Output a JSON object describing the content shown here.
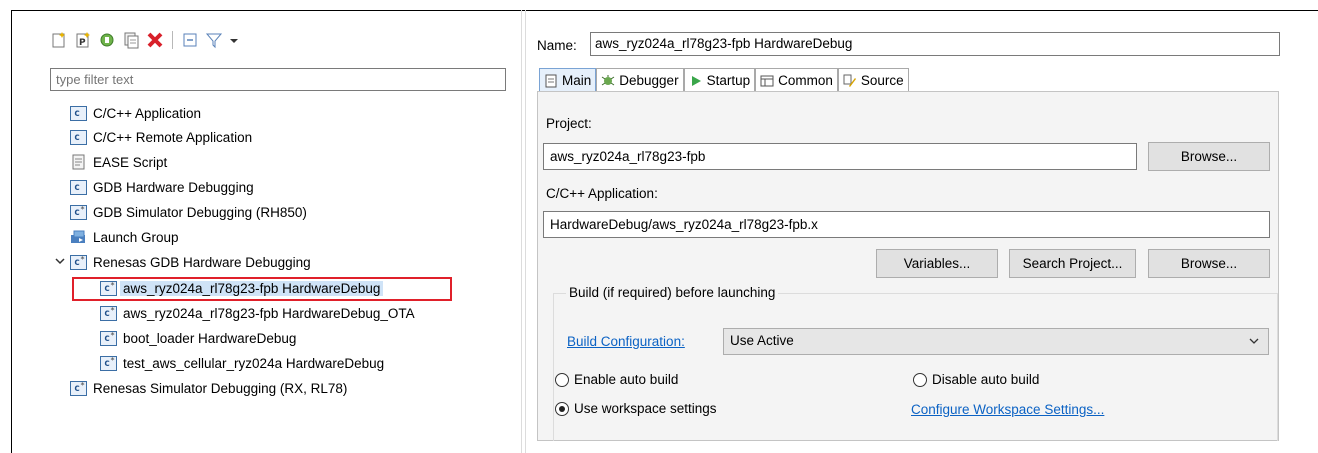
{
  "left_panel": {
    "toolbar": [
      {
        "icon": "new-launch-config-icon"
      },
      {
        "icon": "new-prototype-icon"
      },
      {
        "icon": "export-icon"
      },
      {
        "icon": "duplicate-icon"
      },
      {
        "icon": "delete-icon"
      },
      {
        "icon": "collapse-all-icon"
      },
      {
        "icon": "filter-icon"
      },
      {
        "icon": "view-menu-icon"
      }
    ],
    "filter_placeholder": "type filter text",
    "tree": [
      {
        "label": "C/C++ Application",
        "icon": "c-icon"
      },
      {
        "label": "C/C++ Remote Application",
        "icon": "c-icon"
      },
      {
        "label": "EASE Script",
        "icon": "script-icon"
      },
      {
        "label": "GDB Hardware Debugging",
        "icon": "c-icon"
      },
      {
        "label": "GDB Simulator Debugging (RH850)",
        "icon": "c-star-icon"
      },
      {
        "label": "Launch Group",
        "icon": "launch-group-icon"
      },
      {
        "label": "Renesas GDB Hardware Debugging",
        "icon": "c-star-icon"
      },
      {
        "label": "aws_ryz024a_rl78g23-fpb HardwareDebug",
        "icon": "c-star-icon"
      },
      {
        "label": "aws_ryz024a_rl78g23-fpb HardwareDebug_OTA",
        "icon": "c-star-icon"
      },
      {
        "label": "boot_loader HardwareDebug",
        "icon": "c-star-icon"
      },
      {
        "label": "test_aws_cellular_ryz024a HardwareDebug",
        "icon": "c-star-icon"
      },
      {
        "label": "Renesas Simulator Debugging (RX, RL78)",
        "icon": "c-star-icon"
      }
    ]
  },
  "right_panel": {
    "name_label": "Name:",
    "name_value": "aws_ryz024a_rl78g23-fpb HardwareDebug",
    "tabs": [
      {
        "label": "Main",
        "icon": "main-tab-icon"
      },
      {
        "label": "Debugger",
        "icon": "debugger-tab-icon"
      },
      {
        "label": "Startup",
        "icon": "startup-tab-icon"
      },
      {
        "label": "Common",
        "icon": "common-tab-icon"
      },
      {
        "label": "Source",
        "icon": "source-tab-icon"
      }
    ],
    "project_label": "Project:",
    "project_value": "aws_ryz024a_rl78g23-fpb",
    "browse_label": "Browse...",
    "app_label": "C/C++ Application:",
    "app_value": "HardwareDebug/aws_ryz024a_rl78g23-fpb.x",
    "variables_label": "Variables...",
    "search_project_label": "Search Project...",
    "browse2_label": "Browse...",
    "build_group_title": "Build (if required) before launching",
    "build_config_link": "Build Configuration:",
    "build_config_value": "Use Active",
    "radio_enable": "Enable auto build",
    "radio_disable": "Disable auto build",
    "radio_workspace": "Use workspace settings",
    "configure_link": "Configure Workspace Settings..."
  },
  "colors": {
    "highlight_box": "#e0202a",
    "link": "#0b62c4",
    "selection": "#cfe3f7"
  }
}
